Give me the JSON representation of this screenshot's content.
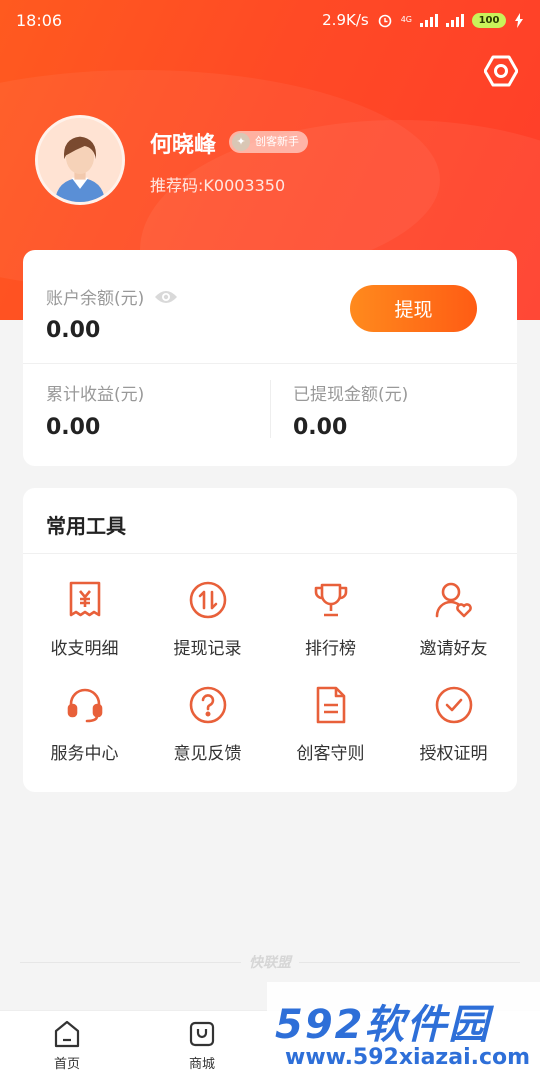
{
  "status": {
    "time": "18:06",
    "speed": "2.9K/s",
    "network": "4G",
    "battery": "100"
  },
  "profile": {
    "name": "何晓峰",
    "badge": "创客新手",
    "referral": "推荐码:K0003350"
  },
  "balance": {
    "label": "账户余额(元)",
    "value": "0.00",
    "withdraw_button": "提现",
    "cumulative_label": "累计收益(元)",
    "cumulative_value": "0.00",
    "withdrawn_label": "已提现金额(元)",
    "withdrawn_value": "0.00"
  },
  "tools": {
    "title": "常用工具",
    "items": [
      {
        "label": "收支明细",
        "icon": "receipt-yen-icon"
      },
      {
        "label": "提现记录",
        "icon": "transfer-icon"
      },
      {
        "label": "排行榜",
        "icon": "trophy-icon"
      },
      {
        "label": "邀请好友",
        "icon": "invite-user-icon"
      },
      {
        "label": "服务中心",
        "icon": "headset-icon"
      },
      {
        "label": "意见反馈",
        "icon": "question-icon"
      },
      {
        "label": "创客守则",
        "icon": "document-icon"
      },
      {
        "label": "授权证明",
        "icon": "check-circle-icon"
      }
    ]
  },
  "footer_brand": "快联盟",
  "tabbar": {
    "tabs": [
      {
        "label": "首页"
      },
      {
        "label": "商城"
      }
    ]
  },
  "watermark": {
    "main": "592软件园",
    "url": "www.592xiazai.com"
  },
  "colors": {
    "accent": "#ff4f22",
    "icon": "#e8603a"
  }
}
